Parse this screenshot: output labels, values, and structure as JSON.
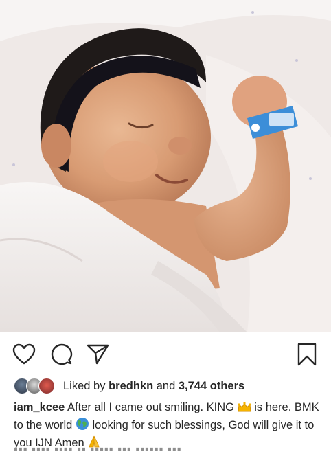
{
  "post": {
    "image_icon": "sleeping-newborn-photo",
    "liked_by_prefix": "Liked by",
    "liked_by_user": "bredhkn",
    "liked_by_conjunction": "and",
    "liked_by_others": "3,744 others",
    "author": "iam_kcee",
    "caption_part1": "After all I came out smiling. KING",
    "caption_part2": "is here. BMK to the world",
    "caption_part3": "looking for such blessings, God will give it to you IJN Amen",
    "emoji_crown": "crown-emoji",
    "emoji_globe": "globe-emoji",
    "emoji_pray": "folded-hands-emoji"
  },
  "actions": {
    "like_icon": "heart-icon",
    "comment_icon": "comment-icon",
    "share_icon": "share-icon",
    "save_icon": "bookmark-icon"
  },
  "colors": {
    "text": "#262626",
    "accent_crown": "#f5b301",
    "globe_blue": "#3a8fd9",
    "globe_green": "#4caf50",
    "wristband": "#3c8ed8"
  }
}
